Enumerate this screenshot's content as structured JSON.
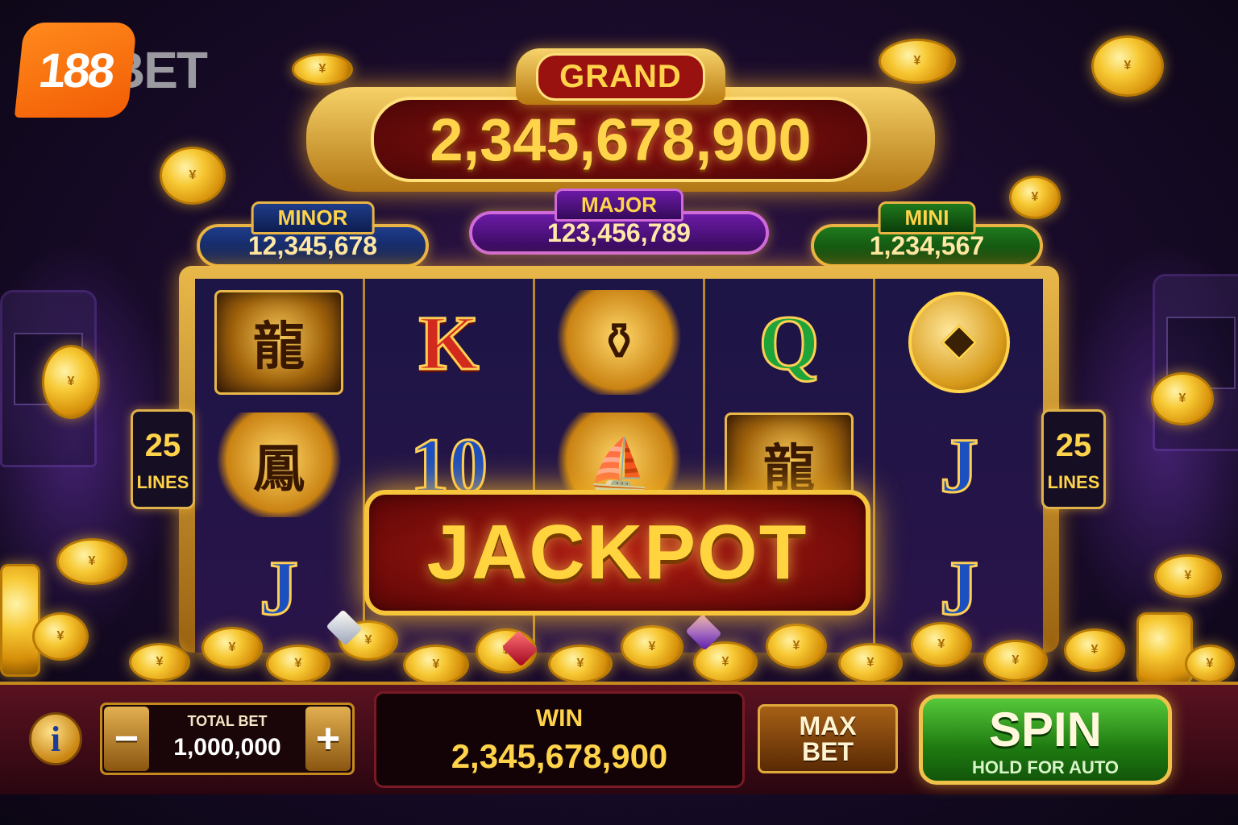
{
  "brand": {
    "logo_number": "188",
    "logo_word": "BET"
  },
  "jackpots": {
    "grand": {
      "label": "GRAND",
      "value": "2,345,678,900"
    },
    "minor": {
      "label": "MINOR",
      "value": "12,345,678"
    },
    "major": {
      "label": "MAJOR",
      "value": "123,456,789"
    },
    "mini": {
      "label": "MINI",
      "value": "1,234,567"
    }
  },
  "reels": [
    [
      "dragon",
      "phoenix",
      "J"
    ],
    [
      "K",
      "10",
      ""
    ],
    [
      "pot-of-gold",
      "ship",
      ""
    ],
    [
      "Q",
      "dragon",
      ""
    ],
    [
      "coin",
      "J",
      "J"
    ]
  ],
  "lines": {
    "left": {
      "count": "25",
      "label": "LINES"
    },
    "right": {
      "count": "25",
      "label": "LINES"
    }
  },
  "banner": {
    "text": "JACKPOT"
  },
  "controls": {
    "info_icon": "i",
    "minus": "−",
    "plus": "+",
    "total_bet_label": "TOTAL BET",
    "total_bet_value": "1,000,000",
    "win_label": "WIN",
    "win_value": "2,345,678,900",
    "max_bet_line1": "MAX",
    "max_bet_line2": "BET",
    "spin_label": "SPIN",
    "spin_sub": "HOLD FOR AUTO"
  },
  "colors": {
    "gold": "#ffd34a",
    "red_panel": "#8d1212",
    "spin_green": "#1e7a10",
    "brand_orange": "#f25c05"
  }
}
